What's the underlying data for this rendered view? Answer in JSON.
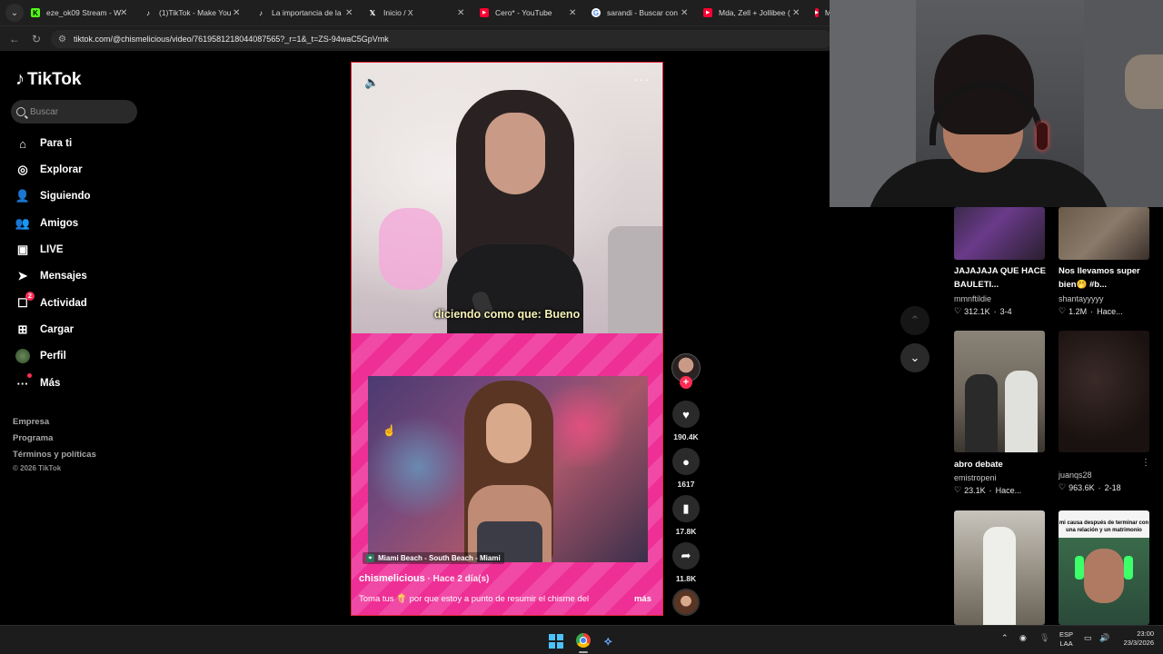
{
  "browser": {
    "tabs": [
      {
        "title": "eze_ok09 Stream - W",
        "icon": "kick-icon",
        "color": "#53fc18"
      },
      {
        "title": "(1)TikTok - Make You",
        "icon": "tiktok-icon",
        "color": "#ffffff"
      },
      {
        "title": "La importancia de la",
        "icon": "tiktok-icon",
        "color": "#ffffff"
      },
      {
        "title": "Inicio / X",
        "icon": "x-icon",
        "color": "#ffffff"
      },
      {
        "title": "Cero* - YouTube",
        "icon": "youtube-icon",
        "color": "#ff0033"
      },
      {
        "title": "sarandi - Buscar con",
        "icon": "google-icon",
        "color": "#ffffff"
      },
      {
        "title": "Mda, Zell + Jollibee (",
        "icon": "youtube-icon",
        "color": "#ff0033"
      },
      {
        "title": "M",
        "icon": "youtube-icon",
        "color": "#ff0033"
      }
    ],
    "url": "tiktok.com/@chismelicious/video/7619581218044087565?_r=1&_t=ZS-94waC5GpVmk"
  },
  "sidebar": {
    "logo": "TikTok",
    "search_placeholder": "Buscar",
    "items": [
      {
        "label": "Para ti",
        "icon": "home-icon"
      },
      {
        "label": "Explorar",
        "icon": "compass-icon"
      },
      {
        "label": "Siguiendo",
        "icon": "following-icon"
      },
      {
        "label": "Amigos",
        "icon": "friends-icon"
      },
      {
        "label": "LIVE",
        "icon": "live-icon"
      },
      {
        "label": "Mensajes",
        "icon": "messages-icon"
      },
      {
        "label": "Actividad",
        "icon": "activity-icon",
        "badge": "2"
      },
      {
        "label": "Cargar",
        "icon": "upload-icon"
      },
      {
        "label": "Perfil",
        "icon": "profile-avatar-icon"
      },
      {
        "label": "Más",
        "icon": "more-icon"
      }
    ],
    "footer": [
      "Empresa",
      "Programa",
      "Términos y políticas"
    ],
    "copyright": "© 2026 TikTok"
  },
  "video": {
    "caption": "diciendo como que: Bueno",
    "location": "Miami Beach - South Beach - Miami",
    "author": "chismelicious",
    "posted": " · Hace 2 día(s)",
    "description": "Toma tus 🍿 por que estoy a punto de resumir el chisme del",
    "more": "más"
  },
  "actions": {
    "likes": "190.4K",
    "comments": "1617",
    "saves": "17.8K",
    "shares": "11.8K"
  },
  "related": [
    {
      "title": "JAJAJAJA QUE HACE BAULETI...",
      "user": "mmnftildie",
      "likes": "312.1K",
      "date": "3-4"
    },
    {
      "title": "Nos llevamos super bien🤭 #b...",
      "user": "shantayyyyy",
      "likes": "1.2M",
      "date": "Hace..."
    },
    {
      "title": "abro debate",
      "user": "emistropeni",
      "likes": "23.1K",
      "date": "Hace..."
    },
    {
      "title": "",
      "user": "juanqs28",
      "likes": "963.6K",
      "date": "2-18"
    },
    {
      "overlay": ""
    },
    {
      "overlay": "mi causa después de terminar con una relación y un matrimonio"
    }
  ],
  "taskbar": {
    "lang1": "ESP",
    "lang2": "LAA",
    "time": "23:00",
    "date": "23/3/2026"
  }
}
